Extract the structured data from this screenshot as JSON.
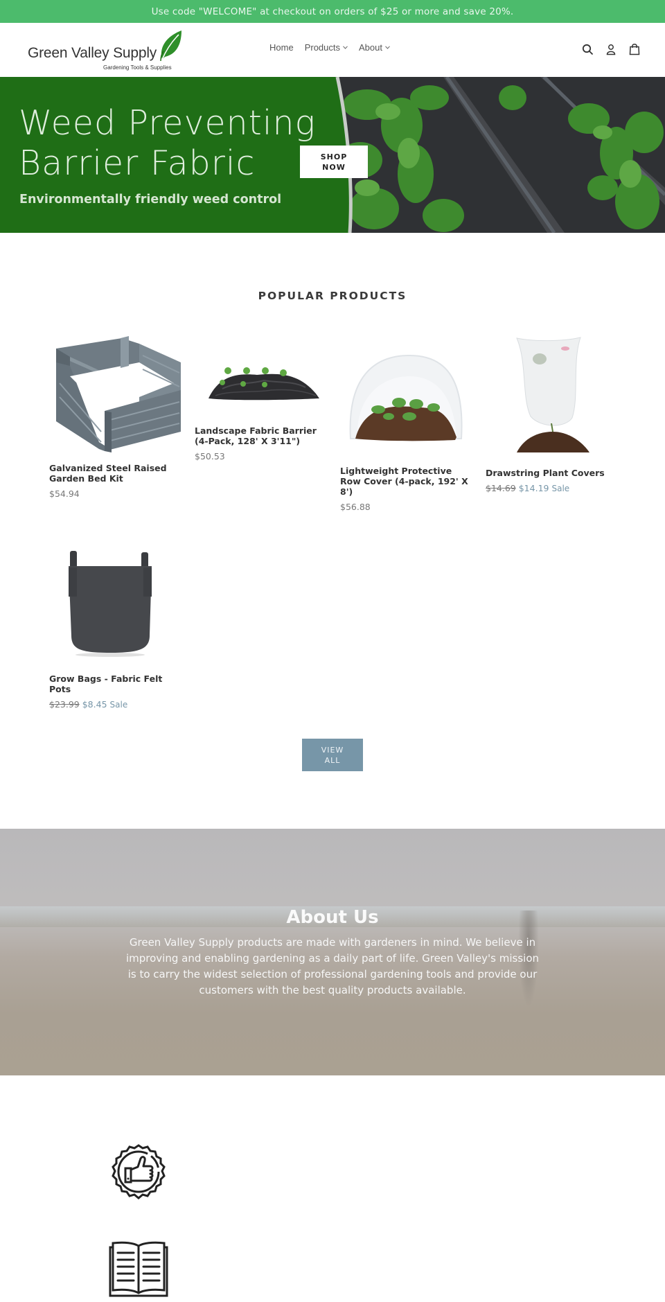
{
  "announcement": "Use code \"WELCOME\" at checkout on orders of $25 or more and save 20%.",
  "header": {
    "logo": {
      "name": "Green Valley Supply",
      "tagline": "Gardening Tools & Supplies"
    },
    "nav": [
      {
        "label": "Home",
        "dropdown": false
      },
      {
        "label": "Products",
        "dropdown": true
      },
      {
        "label": "About",
        "dropdown": true
      }
    ],
    "icons": [
      "search-icon",
      "account-icon",
      "cart-icon"
    ]
  },
  "hero": {
    "title_line1": "Weed Preventing",
    "title_line2": "Barrier Fabric",
    "subtitle": "Environmentally friendly weed control",
    "button_line1": "SHOP",
    "button_line2": "NOW"
  },
  "popular": {
    "title": "POPULAR PRODUCTS",
    "products": [
      {
        "name": "Galvanized Steel Raised Garden Bed Kit",
        "price": "$54.94",
        "on_sale": false
      },
      {
        "name": "Landscape Fabric Barrier (4-Pack, 128' X 3'11\")",
        "price": "$50.53",
        "on_sale": false
      },
      {
        "name": "Lightweight Protective Row Cover (4-pack, 192' X 8')",
        "price": "$56.88",
        "on_sale": false
      },
      {
        "name": "Drawstring Plant Covers",
        "original_price": "$14.69",
        "price": "$14.19",
        "sale_label": "Sale",
        "on_sale": true
      },
      {
        "name": "Grow Bags - Fabric Felt Pots",
        "original_price": "$23.99",
        "price": "$8.45",
        "sale_label": "Sale",
        "on_sale": true
      }
    ],
    "view_all_line1": "VIEW",
    "view_all_line2": "ALL"
  },
  "about": {
    "title": "About Us",
    "text": "Green Valley Supply products are made with gardeners in mind. We believe in improving and enabling gardening as a daily part of life. Green Valley's mission is to carry the widest selection of professional gardening tools and provide our customers with the best quality products available."
  },
  "features": {
    "icons": [
      "quality-badge-thumbs-up-icon",
      "open-book-icon"
    ]
  },
  "colors": {
    "announcement_bg": "#4cbb6c",
    "hero_green": "#1f6e16",
    "accent_button": "#7796a8",
    "text_dark": "#3a3a3a"
  }
}
